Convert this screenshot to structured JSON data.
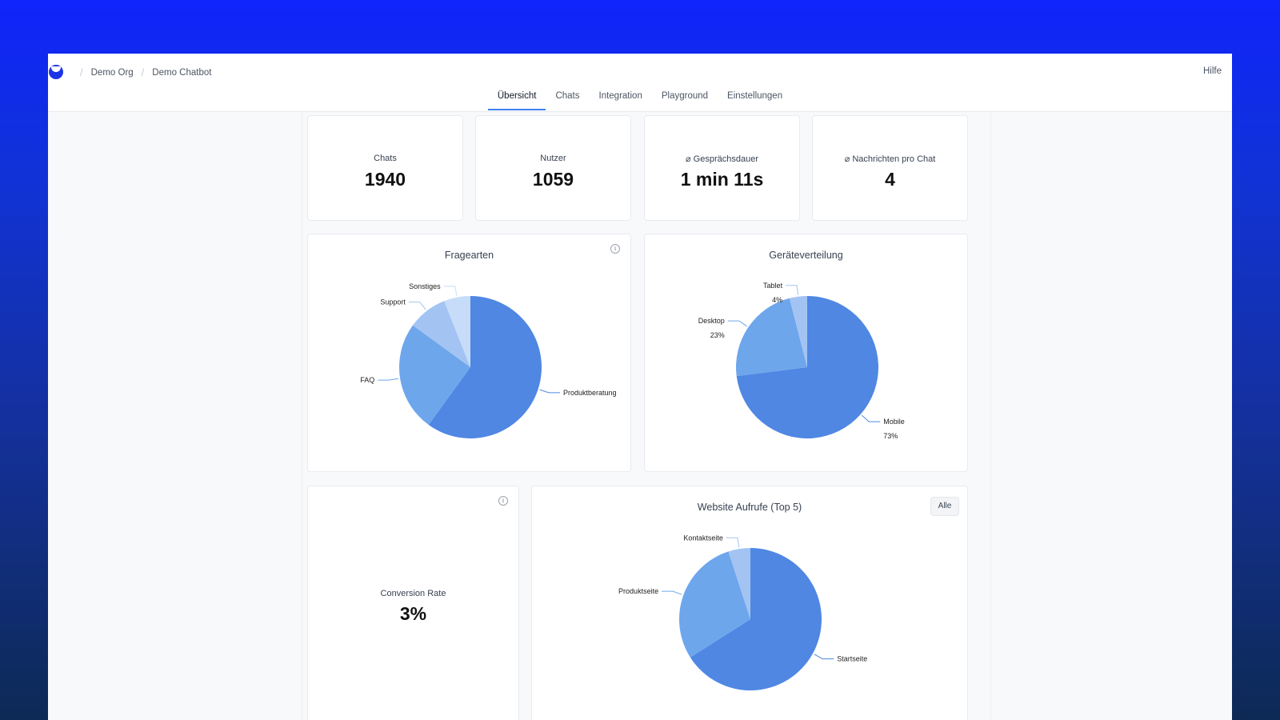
{
  "breadcrumb": {
    "org": "Demo Org",
    "bot": "Demo Chatbot"
  },
  "help_label": "Hilfe",
  "tabs": [
    {
      "label": "Übersicht",
      "active": true
    },
    {
      "label": "Chats",
      "active": false
    },
    {
      "label": "Integration",
      "active": false
    },
    {
      "label": "Playground",
      "active": false
    },
    {
      "label": "Einstellungen",
      "active": false
    }
  ],
  "stats": [
    {
      "label": "Chats",
      "value": "1940"
    },
    {
      "label": "Nutzer",
      "value": "1059"
    },
    {
      "label": "⌀ Gesprächsdauer",
      "value": "1 min 11s"
    },
    {
      "label": "⌀ Nachrichten pro Chat",
      "value": "4"
    }
  ],
  "conversion": {
    "label": "Conversion Rate",
    "value": "3%"
  },
  "alle_label": "Alle",
  "info_glyph": "i",
  "colors": {
    "dark": "#4f87e3",
    "mid": "#6ea6ec",
    "light": "#a3c4f3",
    "lighter": "#c6dcf8"
  },
  "chart_data": [
    {
      "type": "pie",
      "title": "Fragearten",
      "slices": [
        {
          "label": "Produktberatung",
          "value": 60,
          "color": "#4f87e3"
        },
        {
          "label": "FAQ",
          "value": 25,
          "color": "#6ea6ec"
        },
        {
          "label": "Support",
          "value": 9,
          "color": "#a3c4f3"
        },
        {
          "label": "Sonstiges",
          "value": 6,
          "color": "#c6dcf8"
        }
      ]
    },
    {
      "type": "pie",
      "title": "Geräteverteilung",
      "slices": [
        {
          "label": "Mobile",
          "value": 73,
          "display": "73%",
          "color": "#4f87e3"
        },
        {
          "label": "Desktop",
          "value": 23,
          "display": "23%",
          "color": "#6ea6ec"
        },
        {
          "label": "Tablet",
          "value": 4,
          "display": "4%",
          "color": "#a3c4f3"
        }
      ]
    },
    {
      "type": "pie",
      "title": "Website Aufrufe (Top 5)",
      "slices": [
        {
          "label": "Startseite",
          "value": 66,
          "color": "#4f87e3"
        },
        {
          "label": "Produktseite",
          "value": 29,
          "color": "#6ea6ec"
        },
        {
          "label": "Kontaktseite",
          "value": 5,
          "color": "#a3c4f3"
        }
      ]
    }
  ]
}
